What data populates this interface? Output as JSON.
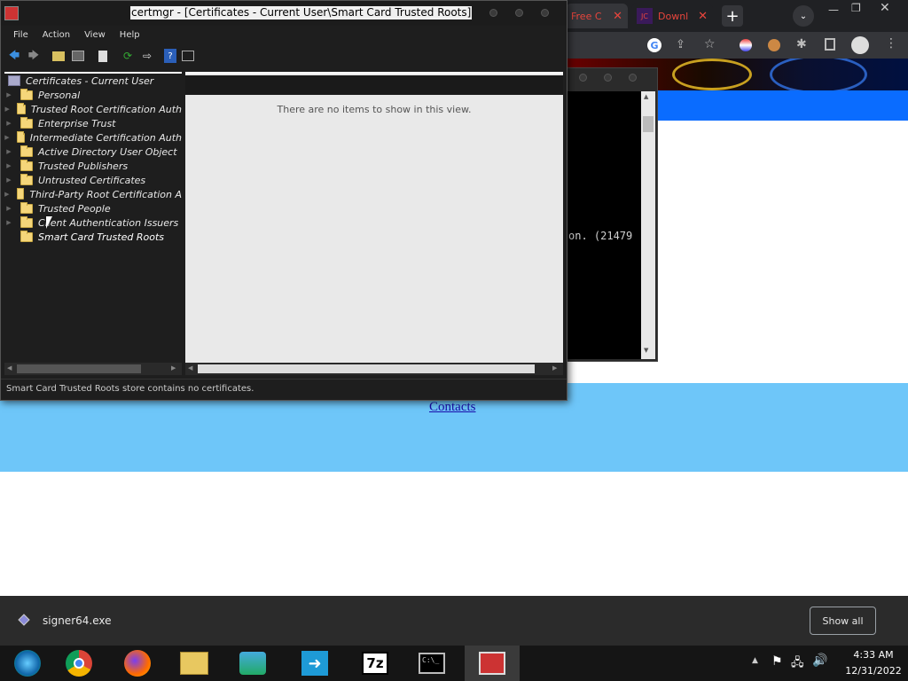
{
  "mmc": {
    "title": "certmgr - [Certificates - Current User\\Smart Card Trusted Roots]",
    "menu": [
      "File",
      "Action",
      "View",
      "Help"
    ],
    "tree_root": "Certificates - Current User",
    "tree_items": [
      {
        "label": "Personal",
        "has_arrow": true
      },
      {
        "label": "Trusted Root Certification Auth",
        "has_arrow": true
      },
      {
        "label": "Enterprise Trust",
        "has_arrow": true
      },
      {
        "label": "Intermediate Certification Auth",
        "has_arrow": true
      },
      {
        "label": "Active Directory User Object",
        "has_arrow": true
      },
      {
        "label": "Trusted Publishers",
        "has_arrow": true
      },
      {
        "label": "Untrusted Certificates",
        "has_arrow": true
      },
      {
        "label": "Third-Party Root Certification A",
        "has_arrow": true
      },
      {
        "label": "Trusted People",
        "has_arrow": true
      },
      {
        "label": "Client Authentication Issuers",
        "has_arrow": true
      },
      {
        "label": "Smart Card Trusted Roots",
        "has_arrow": false,
        "selected": true
      }
    ],
    "empty_message": "There are no items to show in this view.",
    "status": "Smart Card Trusted Roots store contains no certificates."
  },
  "browser": {
    "tabs": [
      {
        "label": "Free C",
        "icon": "web-icon"
      },
      {
        "label": "Downl",
        "icon": "app-icon"
      }
    ],
    "contacts_link": "Contacts"
  },
  "console": {
    "text": "on. (21479"
  },
  "download_bar": {
    "filename": "signer64.exe",
    "show_all": "Show all"
  },
  "taskbar": {
    "apps": [
      "media-center-icon",
      "chrome-icon",
      "firefox-icon",
      "file-explorer-icon",
      "network-icon",
      "transfer-icon",
      "7zip-icon",
      "cmd-icon",
      "toolbox-icon"
    ],
    "time": "4:33 AM",
    "date": "12/31/2022"
  }
}
